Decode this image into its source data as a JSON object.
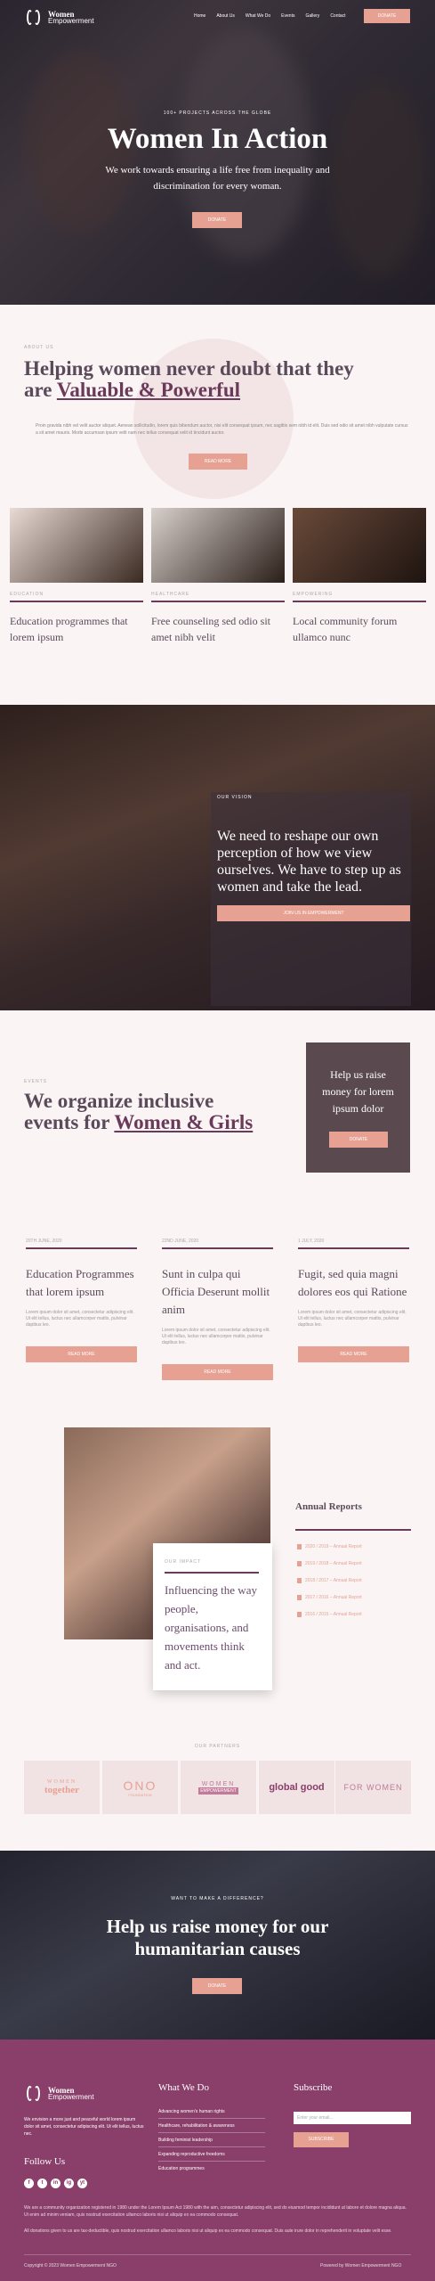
{
  "brand": {
    "name": "Women",
    "tagline": "Empowerment"
  },
  "nav": {
    "links": [
      "Home",
      "About Us",
      "What We Do",
      "Events",
      "Gallery",
      "Contact"
    ],
    "donate": "DONATE"
  },
  "hero": {
    "kicker": "100+ PROJECTS ACROSS THE GLOBE",
    "title": "Women In Action",
    "subtitle": "We work towards ensuring a life free from inequality and discrimination for every woman.",
    "button": "DONATE"
  },
  "about": {
    "kicker": "ABOUT US",
    "title_plain": "Helping women never doubt that they are",
    "title_emph": "Valuable & Powerful",
    "text": "Proin gravida nibh vel velit auctor aliquet. Aenean sollicitudin, lorem quis bibendum auctor, nisi elit consequat ipsum, nec sagittis sem nibh id elit. Duis sed odio sit amet nibh vulputate cursus a sit amet mauris. Morbi accumsan ipsum velit nam nec tellus consequat velit id tincidunt auctor.",
    "button": "READ MORE",
    "cards": [
      {
        "kicker": "EDUCATION",
        "title": "Education programmes that lorem ipsum",
        "colors": [
          "#e8dad4",
          "#3a2a22"
        ]
      },
      {
        "kicker": "HEALTHCARE",
        "title": "Free counseling sed odio sit amet nibh velit",
        "colors": [
          "#d8d0cc",
          "#2a1e18"
        ]
      },
      {
        "kicker": "EMPOWERING",
        "title": "Local community forum ullamco nunc",
        "colors": [
          "#6a4a3a",
          "#1e1410"
        ]
      }
    ]
  },
  "reshape": {
    "kicker": "OUR VISION",
    "text": "We need to reshape our own perception of how we view ourselves. We have to step up as women and take the lead.",
    "button": "JOIN US IN EMPOWERMENT"
  },
  "events": {
    "kicker": "EVENTS",
    "title_plain": "We organize inclusive events for",
    "title_emph": "Women & Girls",
    "raise_text": "Help us raise money for lorem ipsum dolor",
    "raise_button": "DONATE",
    "items": [
      {
        "date": "20TH JUNE, 2020",
        "title": "Education Programmes that lorem ipsum",
        "desc": "Lorem ipsum dolor sit amet, consectetur adipiscing elit. Ut elit tellus, luctus nec ullamcorper mattis, pulvinar dapibus leo.",
        "button": "READ MORE"
      },
      {
        "date": "22ND JUNE, 2020",
        "title": "Sunt in culpa qui Officia Deserunt mollit anim",
        "desc": "Lorem ipsum dolor sit amet, consectetur adipiscing elit. Ut elit tellus, luctus nec ullamcorper mattis, pulvinar dapibus leo.",
        "button": "READ MORE"
      },
      {
        "date": "1 JULY, 2020",
        "title": "Fugit, sed quia magni dolores eos qui Ratione",
        "desc": "Lorem ipsum dolor sit amet, consectetur adipiscing elit. Ut elit tellus, luctus nec ullamcorper mattis, pulvinar dapibus leo.",
        "button": "READ MORE"
      }
    ]
  },
  "impact": {
    "kicker": "OUR IMPACT",
    "text": "Influencing the way people, organisations, and movements think and act.",
    "reports_title": "Annual Reports",
    "reports": [
      "2020 / 2019 – Annual Report",
      "2019 / 2018 – Annual Report",
      "2018 / 2017 – Annual Report",
      "2017 / 2016 – Annual Report",
      "2016 / 2015 – Annual Report"
    ]
  },
  "partners": {
    "kicker": "OUR PARTNERS",
    "logos": [
      {
        "line1": "WOMEN",
        "line2": "together",
        "color": "#e7a193"
      },
      {
        "line1": "ONO",
        "line2": "FOUNDATION",
        "color": "#e7a193"
      },
      {
        "line1": "WOMEN",
        "line2": "EMPOWERMENT",
        "color": "#c07a9a"
      },
      {
        "line1": "global good",
        "line2": "",
        "color": "#8a3e6a"
      },
      {
        "line1": "FOR WOMEN",
        "line2": "",
        "color": "#c07a9a"
      }
    ]
  },
  "cta": {
    "kicker": "WANT TO MAKE A DIFFERENCE?",
    "title": "Help us raise money for our humanitarian causes",
    "button": "DONATE"
  },
  "footer": {
    "about": "We envision a more just and peaceful world lorem ipsum dolor sit amet, consectetur adipiscing elit. Ut elit tellus, luctus nec.",
    "follow": "Follow Us",
    "socials": [
      "f",
      "t",
      "in",
      "ig",
      "yt"
    ],
    "what_title": "What We Do",
    "what_links": [
      "Advancing women's human rights",
      "Healthcare, rehabilitation & awareness",
      "Building feminist leadership",
      "Expanding reproductive freedoms",
      "Education programmes"
    ],
    "subscribe_title": "Subscribe",
    "email_placeholder": "Enter your email...",
    "subscribe_button": "SUBSCRIBE",
    "legal1": "We are a community organization registered in 1980 under the Lorem Ipsum Act 1980 with the aim, consectetur adipiscing elit, sed do eiusmod tempor incididunt ut labore et dolore magna aliqua. Ut enim ad minim veniam, quis nostrud exercitation ullamco laboris nisi ut aliquip ex ea commodo consequat.",
    "legal2": "All donations given to us are tax-deductible, quis nostrud exercitation ullamco laboris nisi ut aliquip ex ea commodo consequat. Duis aute irure dolor in reprehenderit in voluptate velit esse.",
    "copyright": "Copyright © 2023 Women Empowerment NGO",
    "powered": "Powered by Women Empowerment NGO"
  },
  "colors": {
    "accent": "#e7a193",
    "plum": "#6a3a5a",
    "footer": "#8a3e6a"
  }
}
